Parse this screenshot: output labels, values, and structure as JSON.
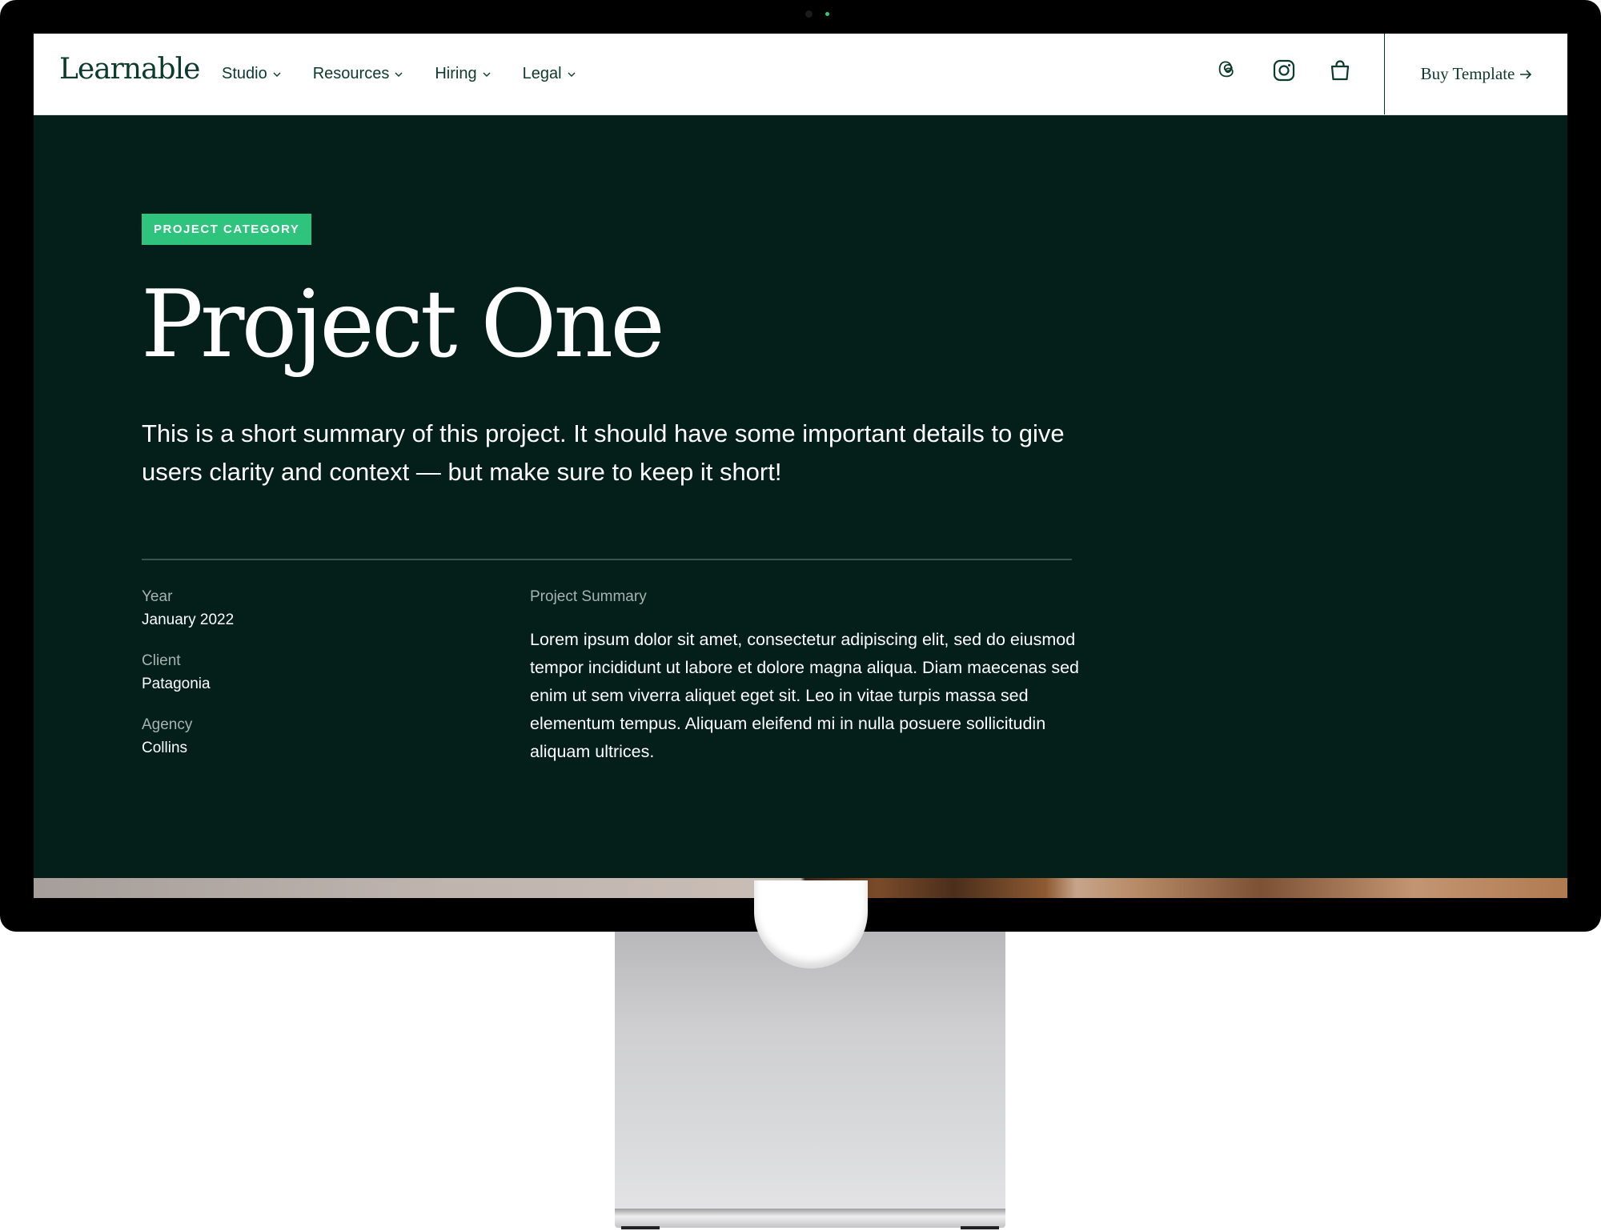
{
  "nav": {
    "logo": "Learnable",
    "menu": [
      {
        "label": "Studio"
      },
      {
        "label": "Resources"
      },
      {
        "label": "Hiring"
      },
      {
        "label": "Legal"
      }
    ],
    "icons": [
      "threads-icon",
      "instagram-icon",
      "shopping-bag-icon"
    ],
    "cta": "Buy Template"
  },
  "hero": {
    "badge": "PROJECT CATEGORY",
    "title": "Project One",
    "summary": "This is a short summary of this project. It should have some important details to give users clarity and context — but make sure to keep it short!"
  },
  "details": {
    "year_label": "Year",
    "year": "January 2022",
    "client_label": "Client",
    "client": "Patagonia",
    "agency_label": "Agency",
    "agency": "Collins",
    "project_summary_label": "Project Summary",
    "project_summary": "Lorem ipsum dolor sit amet, consectetur adipiscing elit, sed do eiusmod tempor incididunt ut labore et dolore magna aliqua. Diam maecenas sed enim ut sem viverra aliquet eget sit. Leo in vitae turpis massa sed elementum tempus. Aliquam eleifend mi in nulla posuere sollicitudin aliquam ultrices."
  },
  "colors": {
    "hero_background": "#041f1a",
    "brand_text": "#0c3a2c",
    "badge": "#2fc47d",
    "muted_label": "#a7b3ae"
  }
}
